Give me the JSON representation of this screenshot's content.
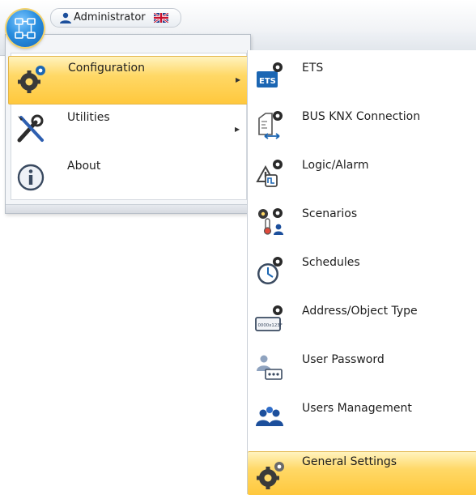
{
  "user": {
    "name": "Administrator",
    "user_icon": "user-icon",
    "flag_icon": "uk-flag-icon"
  },
  "app_orb": {
    "icon": "network-icon"
  },
  "main_menu": {
    "items": [
      {
        "label": "Configuration",
        "icon": "gears-icon",
        "has_submenu": true,
        "selected": true
      },
      {
        "label": "Utilities",
        "icon": "tools-icon",
        "has_submenu": true,
        "selected": false
      },
      {
        "label": "About",
        "icon": "info-icon",
        "has_submenu": false,
        "selected": false
      }
    ]
  },
  "submenu": {
    "items": [
      {
        "label": "ETS",
        "icon": "ets-gear-icon"
      },
      {
        "label": "BUS KNX Connection",
        "icon": "bus-connection-icon"
      },
      {
        "label": "Logic/Alarm",
        "icon": "logic-alarm-icon"
      },
      {
        "label": "Scenarios",
        "icon": "scenarios-icon"
      },
      {
        "label": "Schedules",
        "icon": "schedules-icon"
      },
      {
        "label": "Address/Object Type",
        "icon": "address-object-icon",
        "icon_text": "0000x123F"
      },
      {
        "label": "User Password",
        "icon": "user-password-icon"
      },
      {
        "label": "Users Management",
        "icon": "users-management-icon"
      },
      {
        "label": "General Settings",
        "icon": "general-settings-icon",
        "selected": true
      }
    ]
  },
  "colors": {
    "highlight": "#ffd866",
    "accent_blue": "#1b66b3",
    "menu_background": "#f3f5f8"
  }
}
